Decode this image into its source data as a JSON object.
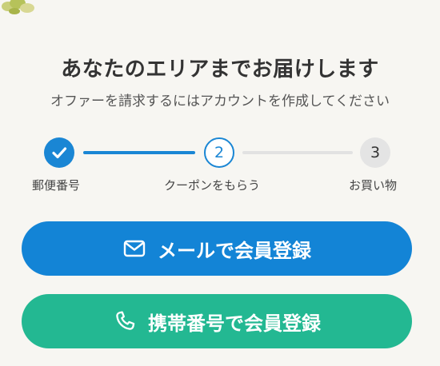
{
  "header": {
    "title": "あなたのエリアまでお届けします",
    "subtitle": "オファーを請求するにはアカウントを作成してください"
  },
  "stepper": {
    "current_step": 2,
    "steps": [
      {
        "number": "1",
        "label": "郵便番号",
        "state": "completed"
      },
      {
        "number": "2",
        "label": "クーポンをもらう",
        "state": "active"
      },
      {
        "number": "3",
        "label": "お買い物",
        "state": "pending"
      }
    ]
  },
  "buttons": {
    "email": {
      "label": "メールで会員登録",
      "icon": "mail-icon",
      "color": "#1384d6"
    },
    "phone": {
      "label": "携帯番号で会員登録",
      "icon": "phone-icon",
      "color": "#23b892"
    }
  },
  "colors": {
    "accent": "#1a86d4",
    "background": "#f7f6f2",
    "inactive": "#e4e4e4"
  }
}
